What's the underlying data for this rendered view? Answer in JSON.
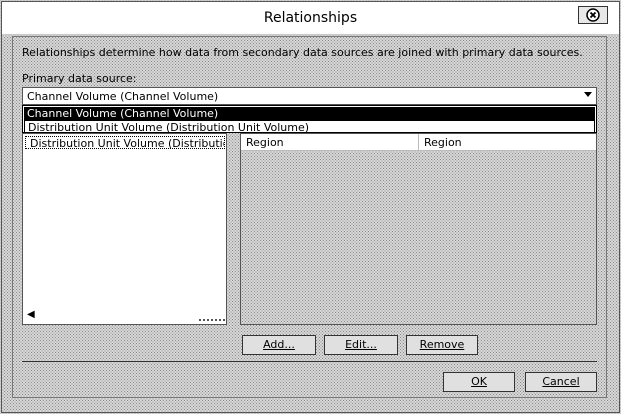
{
  "window": {
    "title": "Relationships",
    "close_icon": "close-icon"
  },
  "description": "Relationships determine how data from secondary data sources are joined with primary data sources.",
  "primary_source": {
    "label": "Primary data source:",
    "selected": "Channel Volume (Channel Volume)",
    "options": [
      "Channel Volume (Channel Volume)",
      "Distribution Unit Volume (Distribution Unit Volume)"
    ]
  },
  "secondary_list": {
    "items": [
      "Distribution Unit Volume (Distribution Unit"
    ]
  },
  "fields_grid": {
    "columns": [
      "Region",
      "Region"
    ]
  },
  "buttons": {
    "add": "Add...",
    "edit": "Edit...",
    "remove": "Remove",
    "ok": "OK",
    "cancel": "Cancel"
  }
}
